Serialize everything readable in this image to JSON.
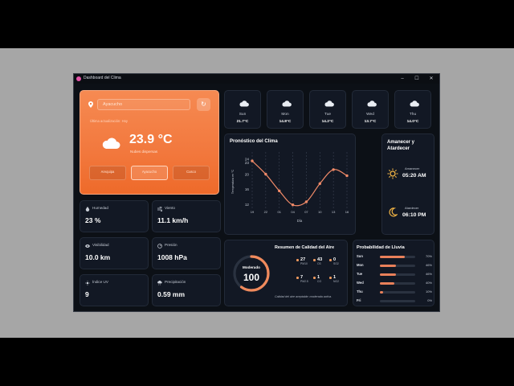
{
  "window": {
    "title": "Dashboard del Clima",
    "minimize": "–",
    "maximize": "☐",
    "close": "✕"
  },
  "location": {
    "search_value": "Ayacucho",
    "updated": "Última actualización: Hoy",
    "temperature": "23.9 °C",
    "description": "Nubes dispersas",
    "cities": [
      {
        "name": "Arequipa",
        "sub": "",
        "active": false
      },
      {
        "name": "Ayacucho",
        "sub": "",
        "active": true
      },
      {
        "name": "Cusco",
        "sub": "",
        "active": false
      }
    ]
  },
  "forecast": [
    {
      "day": "Sun",
      "temp": "21.7°C",
      "icon": "cloud-icon"
    },
    {
      "day": "Mon",
      "temp": "14.8°C",
      "icon": "cloud-icon"
    },
    {
      "day": "Tue",
      "temp": "14.2°C",
      "icon": "cloud-icon"
    },
    {
      "day": "Wed",
      "temp": "13.7°C",
      "icon": "cloud-icon"
    },
    {
      "day": "Thu",
      "temp": "14.0°C",
      "icon": "cloud-icon"
    }
  ],
  "chart_data": {
    "type": "line",
    "title": "Pronóstico del Clima",
    "xlabel": "Día",
    "ylabel": "Temperatura en °C",
    "x": [
      "19",
      "22",
      "01",
      "04",
      "07",
      "10",
      "13",
      "16"
    ],
    "y_ticks": [
      "12",
      "16",
      "20",
      "24",
      "23"
    ],
    "ylim": [
      11,
      25
    ],
    "series": [
      {
        "values": [
          23.5,
          20.0,
          15.6,
          11.9,
          12.7,
          17.5,
          21.2,
          19.6
        ]
      }
    ],
    "grid": "vertical dashed",
    "color": "#f08a68"
  },
  "sun": {
    "title": "Amanecer y Atardecer",
    "sunrise_label": "Amanecer",
    "sunrise": "05:20 AM",
    "sunset_label": "Atardecer",
    "sunset": "06:10 PM"
  },
  "stats": {
    "humidity": {
      "label": "Humedad",
      "value": "23 %"
    },
    "wind": {
      "label": "Viento",
      "value": "11.1 km/h"
    },
    "visibility": {
      "label": "Visibilidad",
      "value": "10.0 km"
    },
    "pressure": {
      "label": "Presión",
      "value": "1008 hPa"
    },
    "uv": {
      "label": "Índice UV",
      "value": "9"
    },
    "precip": {
      "label": "Precipitación",
      "value": "0.59 mm"
    }
  },
  "air": {
    "title": "Resumen de Calidad del Aire",
    "status": "Moderado",
    "aqi": "100",
    "aqi_fraction": 0.6,
    "pollutants": [
      {
        "value": "27",
        "name": "PM10"
      },
      {
        "value": "43",
        "name": "O3"
      },
      {
        "value": "0",
        "name": "SO2"
      },
      {
        "value": "7",
        "name": "PM2.5"
      },
      {
        "value": "1",
        "name": "CO"
      },
      {
        "value": "1",
        "name": "NO2"
      }
    ],
    "note": "Calidad del aire aceptable; moderada activa."
  },
  "rain": {
    "title": "Probabilidad de Lluvia",
    "days": [
      {
        "day": "Sun",
        "pct": "70%",
        "frac": 0.7
      },
      {
        "day": "Mon",
        "pct": "46%",
        "frac": 0.46
      },
      {
        "day": "Tue",
        "pct": "46%",
        "frac": 0.46
      },
      {
        "day": "Wed",
        "pct": "40%",
        "frac": 0.4
      },
      {
        "day": "Thu",
        "pct": "10%",
        "frac": 0.1
      },
      {
        "day": "Fri",
        "pct": "0%",
        "frac": 0.0
      }
    ]
  }
}
